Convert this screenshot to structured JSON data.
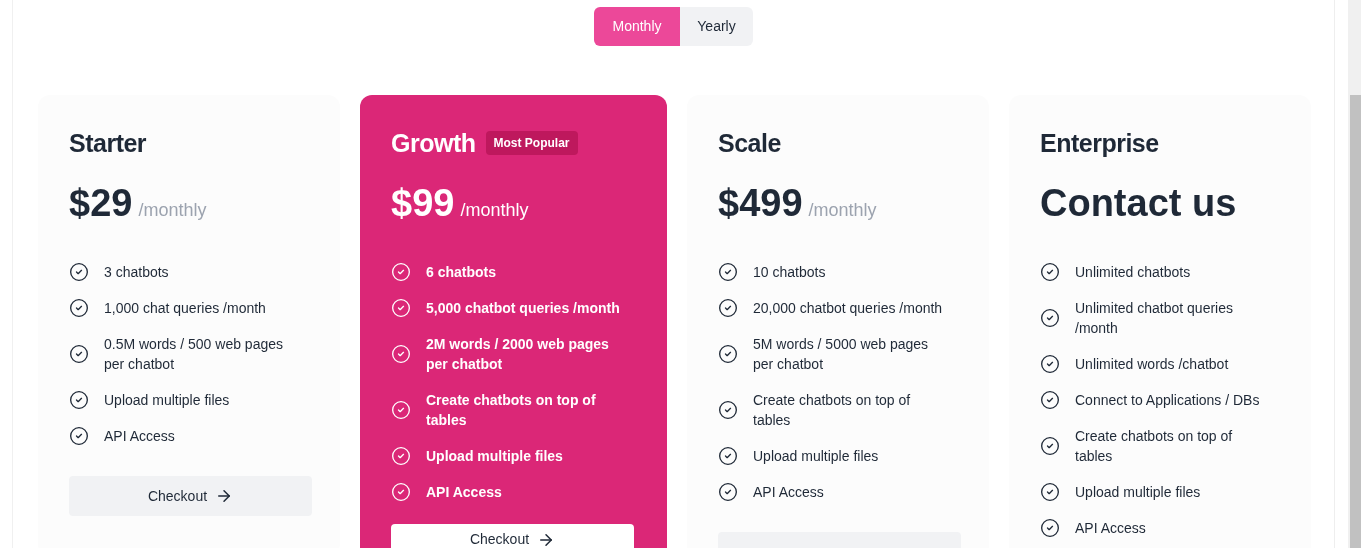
{
  "billing_toggle": [
    {
      "label": "Monthly",
      "selected": true
    },
    {
      "label": "Yearly",
      "selected": false
    }
  ],
  "plans": [
    {
      "name": "Starter",
      "highlighted": false,
      "price": "$29",
      "period": "/monthly",
      "features": [
        "3 chatbots",
        "1,000 chat queries /month",
        "0.5M words / 500 web pages per chatbot",
        "Upload multiple files",
        "API Access"
      ],
      "button": "Checkout"
    },
    {
      "name": "Growth",
      "highlighted": true,
      "badge": "Most Popular",
      "price": "$99",
      "period": "/monthly",
      "features": [
        "6 chatbots",
        "5,000 chatbot queries /month",
        "2M words / 2000 web pages per chatbot",
        "Create chatbots on top of tables",
        "Upload multiple files",
        "API Access"
      ],
      "button": "Checkout"
    },
    {
      "name": "Scale",
      "highlighted": false,
      "price": "$499",
      "period": "/monthly",
      "features": [
        "10 chatbots",
        "20,000 chatbot queries /month",
        "5M words / 5000 web pages per chatbot",
        "Create chatbots on top of tables",
        "Upload multiple files",
        "API Access"
      ],
      "button_cut_off": true
    },
    {
      "name": "Enterprise",
      "highlighted": false,
      "price": "Contact us",
      "features": [
        "Unlimited chatbots",
        "Unlimited chatbot queries /month",
        "Unlimited words /chatbot",
        "Connect to Applications / DBs",
        "Create chatbots on top of tables",
        "Upload multiple files",
        "API Access"
      ]
    }
  ]
}
